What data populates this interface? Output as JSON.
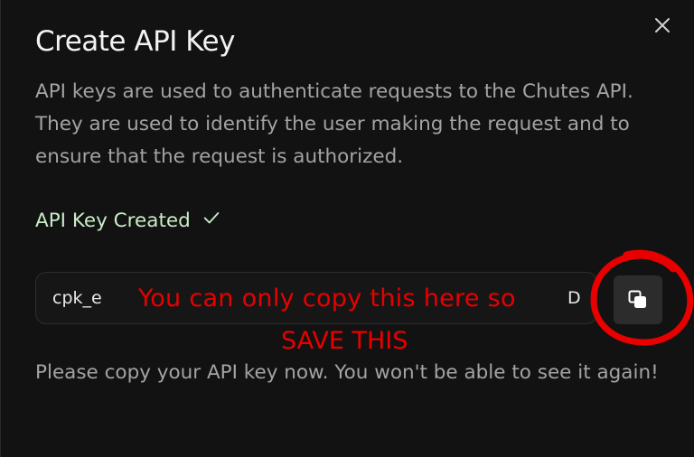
{
  "dialog": {
    "title": "Create API Key",
    "description": "API keys are used to authenticate requests to the Chutes API. They are used to identify the user making the request and to ensure that the request is authorized.",
    "status_text": "API Key Created",
    "key_visible_start": "cpk_e",
    "key_visible_end": "Da",
    "note": "Please copy your API key now. You won't be able to see it again!",
    "close_icon": "close-icon",
    "copy_icon": "copy-icon",
    "check_icon": "check-icon"
  },
  "annotation": {
    "line1": "You can only copy this here so",
    "line2": "SAVE THIS",
    "color": "#e80000"
  },
  "colors": {
    "background": "#121212",
    "success": "#c9ecc6",
    "text_muted": "#a3a3a3"
  }
}
